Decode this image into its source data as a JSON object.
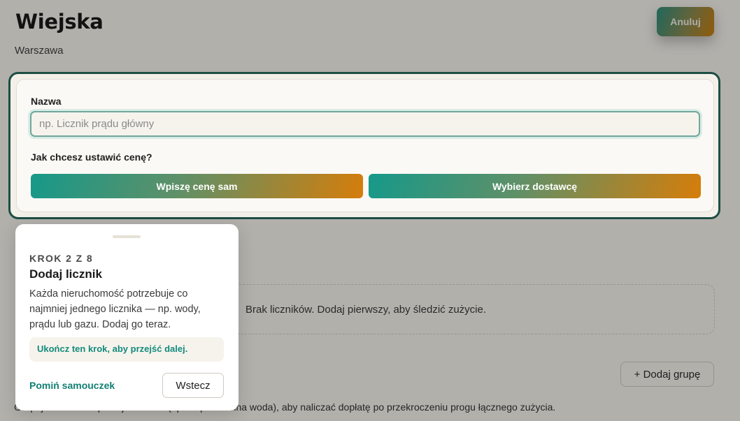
{
  "header": {
    "title": "Wiejska",
    "subtitle": "Warszawa",
    "cancel_label": "Anuluj"
  },
  "form": {
    "name_label": "Nazwa",
    "name_placeholder": "np. Licznik prądu główny",
    "name_value": "",
    "price_question": "Jak chcesz ustawić cenę?",
    "manual_price_label": "Wpiszę cenę sam",
    "choose_supplier_label": "Wybierz dostawcę"
  },
  "meters": {
    "empty_text": "Brak liczników. Dodaj pierwszy, aby śledzić zużycie.",
    "add_group_label": "+ Dodaj grupę",
    "footer_note": "Grupuj liczniki o wspólnej zasadzie (np. ciepła i zimna woda), aby naliczać dopłatę po przekroczeniu progu łącznego zużycia."
  },
  "tour": {
    "step": "KROK 2 Z 8",
    "title": "Dodaj licznik",
    "body": "Każda nieruchomość potrzebuje co najmniej jednego licznika — np. wody, prądu lub gazu. Dodaj go teraz.",
    "hint": "Ukończ ten krok, aby przejść dalej.",
    "skip_label": "Pomiń samouczek",
    "back_label": "Wstecz"
  },
  "colors": {
    "accent": "#138a7c",
    "gradient_start": "#16998a",
    "gradient_end": "#d67d0a",
    "spotlight_border": "#1d4e44"
  }
}
